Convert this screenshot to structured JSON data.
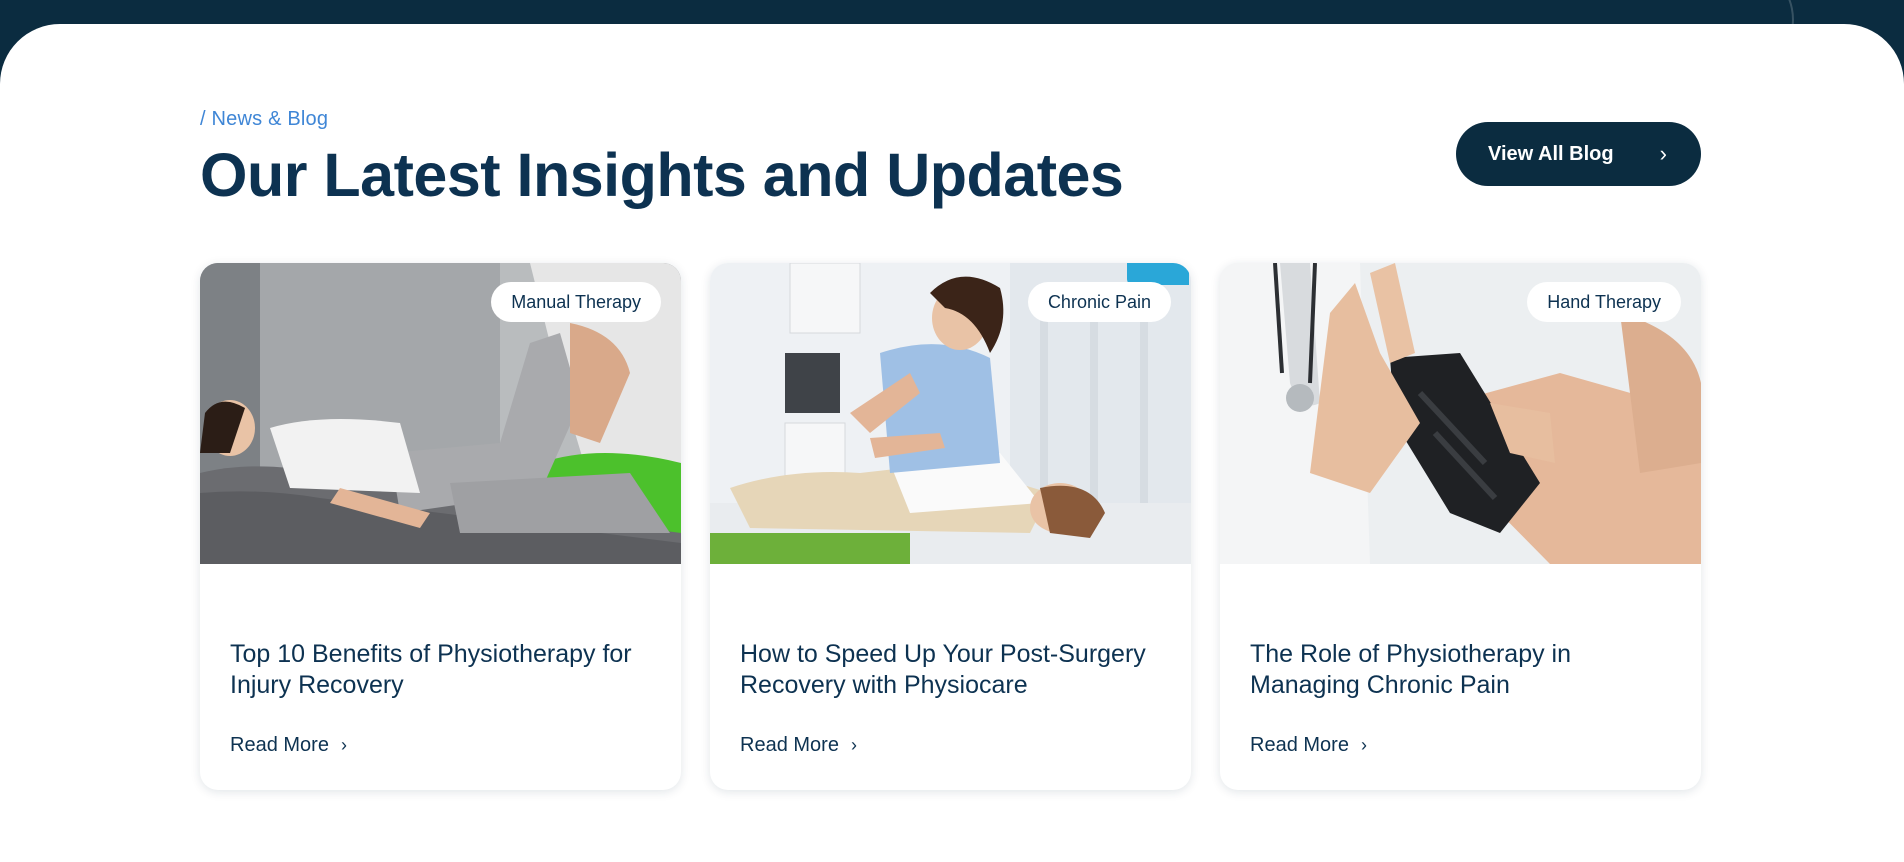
{
  "section": {
    "eyebrow": "/ News & Blog",
    "title": "Our Latest Insights and Updates",
    "view_all_label": "View All Blog"
  },
  "posts": [
    {
      "tag": "Manual Therapy",
      "title": "Top 10 Benefits of Physiotherapy for Injury Recovery",
      "read_more": "Read More",
      "image": "therapist-stretching-patient-leg-photo"
    },
    {
      "tag": "Chronic Pain",
      "title": "How to Speed Up Your Post-Surgery Recovery with Physiocare",
      "read_more": "Read More",
      "image": "therapist-massaging-patient-back-photo"
    },
    {
      "tag": "Hand Therapy",
      "title": "The Role of Physiotherapy in Managing Chronic Pain",
      "read_more": "Read More",
      "image": "wrist-brace-examination-photo"
    }
  ],
  "colors": {
    "navy": "#0b2c40",
    "heading": "#0d3251",
    "accent": "#3f86d6",
    "background": "#ffffff"
  },
  "icons": {
    "button_chevron": "chevron-right-icon",
    "read_more_chevron": "chevron-right-icon"
  }
}
